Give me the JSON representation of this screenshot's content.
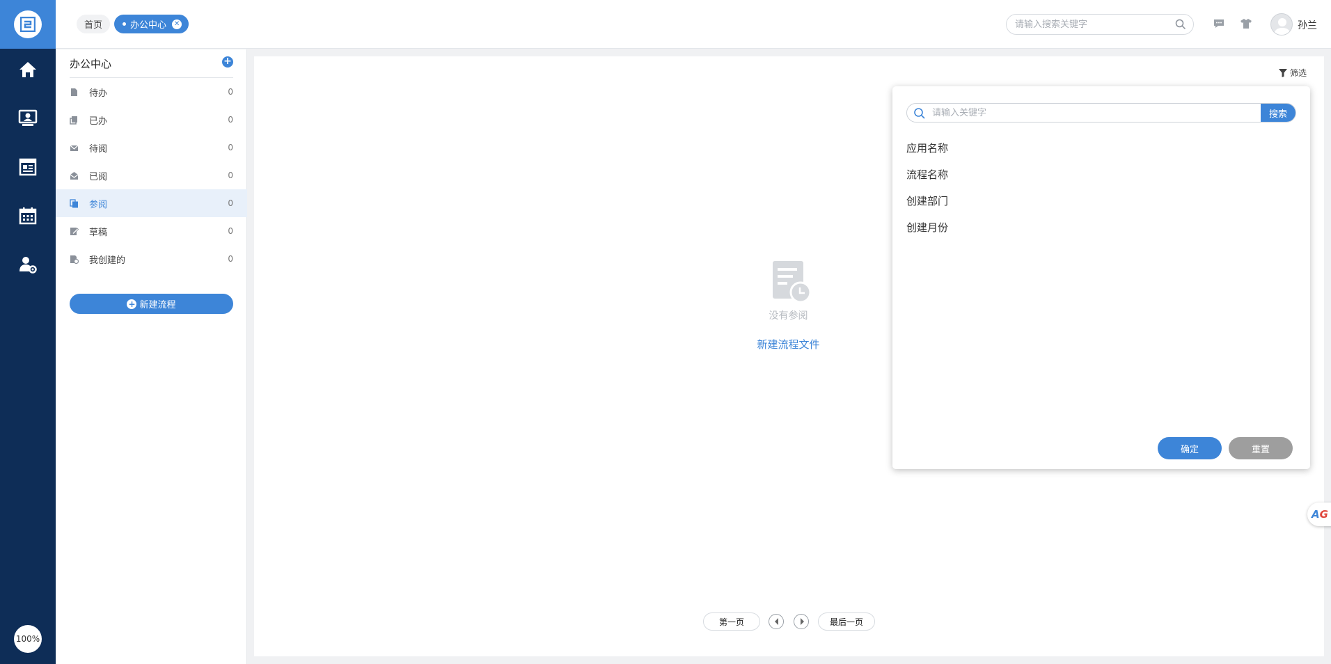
{
  "header": {
    "tabs": [
      {
        "label": "首页"
      },
      {
        "label": "办公中心"
      }
    ],
    "search": {
      "placeholder": "请输入搜索关键字",
      "value": ""
    },
    "user": {
      "name": "孙兰"
    }
  },
  "rail": {
    "items": [
      {
        "icon": "home-icon"
      },
      {
        "icon": "monitor-user-icon"
      },
      {
        "icon": "news-board-icon"
      },
      {
        "icon": "calendar-icon"
      },
      {
        "icon": "user-settings-icon"
      }
    ],
    "zoom": "100%"
  },
  "sidebar": {
    "title": "办公中心",
    "items": [
      {
        "label": "待办",
        "count": "0",
        "icon": "document-icon"
      },
      {
        "label": "已办",
        "count": "0",
        "icon": "document-done-icon"
      },
      {
        "label": "待阅",
        "count": "0",
        "icon": "envelope-icon"
      },
      {
        "label": "已阅",
        "count": "0",
        "icon": "open-envelope-icon"
      },
      {
        "label": "参阅",
        "count": "0",
        "icon": "copy-document-icon"
      },
      {
        "label": "草稿",
        "count": "0",
        "icon": "draft-icon"
      },
      {
        "label": "我创建的",
        "count": "0",
        "icon": "created-document-icon"
      }
    ],
    "active_index": 4,
    "new_button": "新建流程"
  },
  "main": {
    "filter_label": "筛选",
    "empty_text": "没有参阅",
    "empty_link": "新建流程文件",
    "pager": {
      "first": "第一页",
      "last": "最后一页"
    }
  },
  "filter_popup": {
    "search_placeholder": "请输入关键字",
    "search_button": "搜索",
    "fields": [
      "应用名称",
      "流程名称",
      "创建部门",
      "创建月份"
    ],
    "confirm": "确定",
    "reset": "重置"
  },
  "side_badge": {
    "text_a": "A",
    "text_g": "G"
  },
  "colors": {
    "rail": "#0e2d57",
    "accent": "#3d85d8",
    "reset_button": "#9e9e9e"
  }
}
